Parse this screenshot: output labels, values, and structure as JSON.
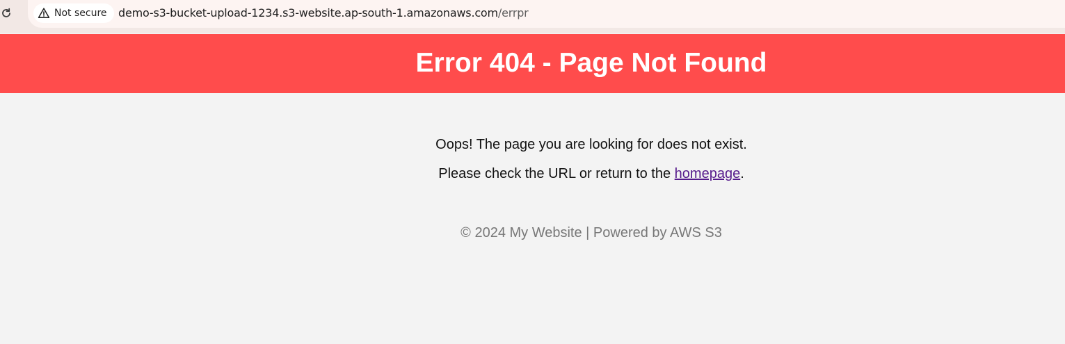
{
  "browser": {
    "security_label": "Not secure",
    "url_host": "demo-s3-bucket-upload-1234.s3-website.ap-south-1.amazonaws.com",
    "url_path": "/errpr"
  },
  "page": {
    "title": "Error 404 - Page Not Found",
    "message": "Oops! The page you are looking for does not exist.",
    "instruction_prefix": "Please check the URL or return to the ",
    "homepage_link": "homepage",
    "instruction_suffix": ".",
    "footer": "© 2024 My Website | Powered by AWS S3"
  },
  "colors": {
    "header_bg": "#ff4c4c",
    "page_bg": "#f3f3f3",
    "link": "#551a8b",
    "footer_text": "#777777"
  }
}
